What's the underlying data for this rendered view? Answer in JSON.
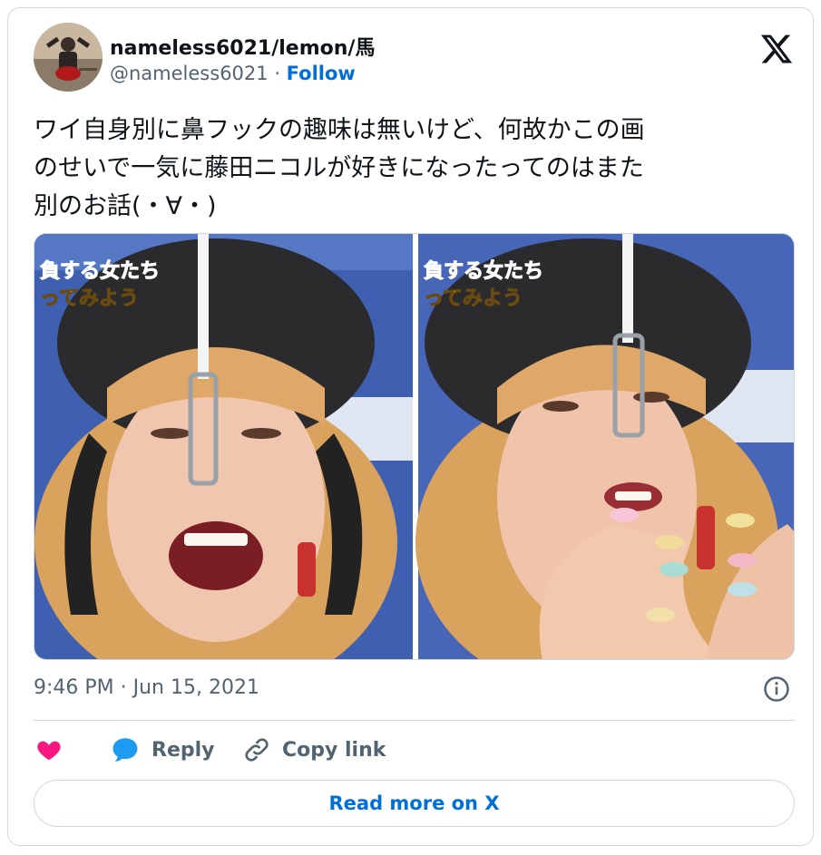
{
  "user": {
    "display_name": "nameless6021/lemon/馬",
    "handle": "@nameless6021",
    "separator": " · ",
    "follow_label": "Follow"
  },
  "tweet": {
    "text": "ワイ自身別に鼻フックの趣味は無いけど、何故かこの画\nのせいで一気に藤田ニコルが好きになったってのはまた\n別のお話(・∀・)",
    "timestamp": "9:46 PM · Jun 15, 2021"
  },
  "media": {
    "left_caption_line1": "負する女たち",
    "left_caption_line2": "ってみよう",
    "right_caption_line1": "負する女たち",
    "right_caption_line2": "ってみよう"
  },
  "actions": {
    "reply_label": "Reply",
    "copy_link_label": "Copy link",
    "read_more_label": "Read more on X"
  },
  "colors": {
    "heart": "#f91880",
    "reply_bubble": "#1d9bf0",
    "link_blue": "#006fd6",
    "muted_text": "#536471",
    "border": "#cfd9de"
  },
  "icons": {
    "platform": "x-logo-icon",
    "like": "heart-icon",
    "reply": "reply-bubble-icon",
    "copy": "link-icon",
    "info": "info-icon"
  }
}
